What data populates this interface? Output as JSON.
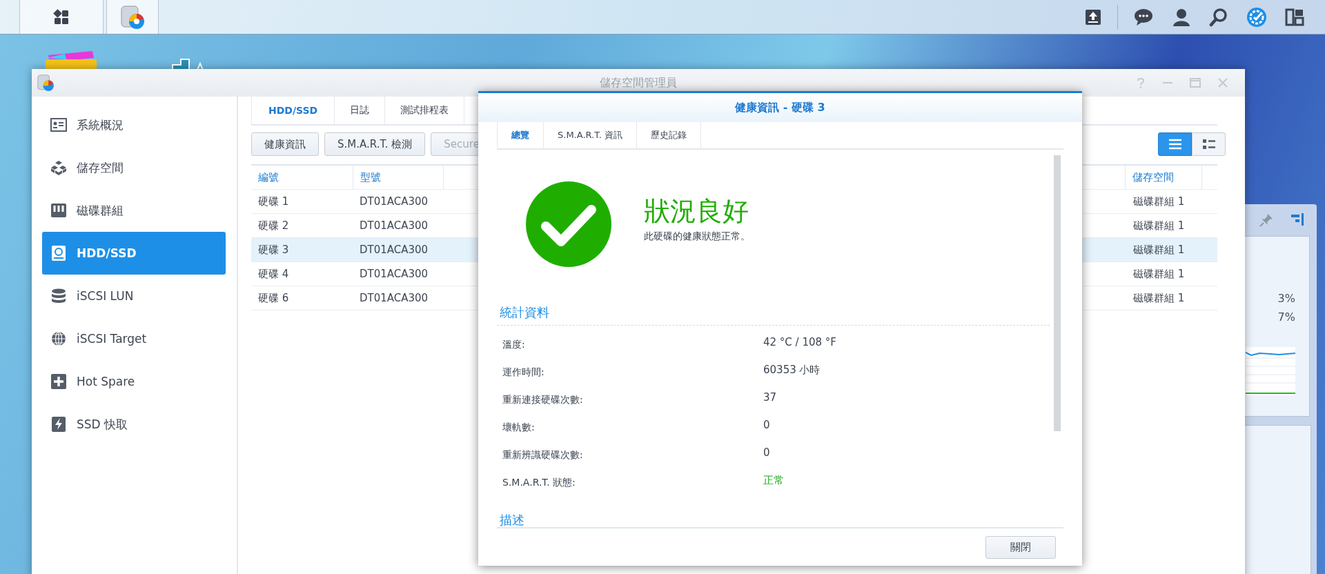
{
  "window": {
    "title": "儲存空間管理員"
  },
  "sidebar": {
    "items": [
      {
        "label": "系統概況",
        "selected": false
      },
      {
        "label": "儲存空間",
        "selected": false
      },
      {
        "label": "磁碟群組",
        "selected": false
      },
      {
        "label": "HDD/SSD",
        "selected": true
      },
      {
        "label": "iSCSI LUN",
        "selected": false
      },
      {
        "label": "iSCSI Target",
        "selected": false
      },
      {
        "label": "Hot Spare",
        "selected": false
      },
      {
        "label": "SSD 快取",
        "selected": false
      }
    ]
  },
  "tabs": [
    {
      "label": "HDD/SSD",
      "selected": true
    },
    {
      "label": "日誌",
      "selected": false
    },
    {
      "label": "測試排程表",
      "selected": false
    }
  ],
  "toolbar": {
    "buttons": [
      {
        "label": "健康資訊",
        "disabled": false
      },
      {
        "label": "S.M.A.R.T. 檢測",
        "disabled": false
      },
      {
        "label": "Secure",
        "disabled": true
      }
    ],
    "view_modes": [
      {
        "kind": "list",
        "selected": true
      },
      {
        "kind": "detail",
        "selected": false
      }
    ]
  },
  "table": {
    "columns": [
      "編號",
      "型號",
      "儲存空間"
    ],
    "rows": [
      {
        "cells": [
          "硬碟 1",
          "DT01ACA300",
          "磁碟群組 1"
        ],
        "selected": false
      },
      {
        "cells": [
          "硬碟 2",
          "DT01ACA300",
          "磁碟群組 1"
        ],
        "selected": false
      },
      {
        "cells": [
          "硬碟 3",
          "DT01ACA300",
          "磁碟群組 1"
        ],
        "selected": true
      },
      {
        "cells": [
          "硬碟 4",
          "DT01ACA300",
          "磁碟群組 1"
        ],
        "selected": false
      },
      {
        "cells": [
          "硬碟 6",
          "DT01ACA300",
          "磁碟群組 1"
        ],
        "selected": false
      }
    ]
  },
  "widget": {
    "readings": [
      "3%",
      "7%"
    ]
  },
  "dialog": {
    "title": "健康資訊 - 硬碟 3",
    "tabs": [
      {
        "label": "總覽",
        "selected": true
      },
      {
        "label": "S.M.A.R.T. 資訊",
        "selected": false
      },
      {
        "label": "歷史記錄",
        "selected": false
      }
    ],
    "status": {
      "kind": "good",
      "heading": "狀況良好",
      "message": "此硬碟的健康狀態正常。"
    },
    "sections": [
      {
        "title": "統計資料",
        "rows": [
          {
            "label": "溫度:",
            "value": "42 °C / 108 °F",
            "kind": "plain"
          },
          {
            "label": "運作時間:",
            "value": "60353 小時",
            "kind": "plain"
          },
          {
            "label": "重新連接硬碟次數:",
            "value": "37",
            "kind": "plain"
          },
          {
            "label": "壞軌數:",
            "value": "0",
            "kind": "plain"
          },
          {
            "label": "重新辨識硬碟次數:",
            "value": "0",
            "kind": "plain"
          },
          {
            "label": "S.M.A.R.T. 狀態:",
            "value": "正常",
            "kind": "ok"
          }
        ]
      },
      {
        "title": "描述"
      }
    ],
    "buttons": [
      "關閉"
    ]
  }
}
